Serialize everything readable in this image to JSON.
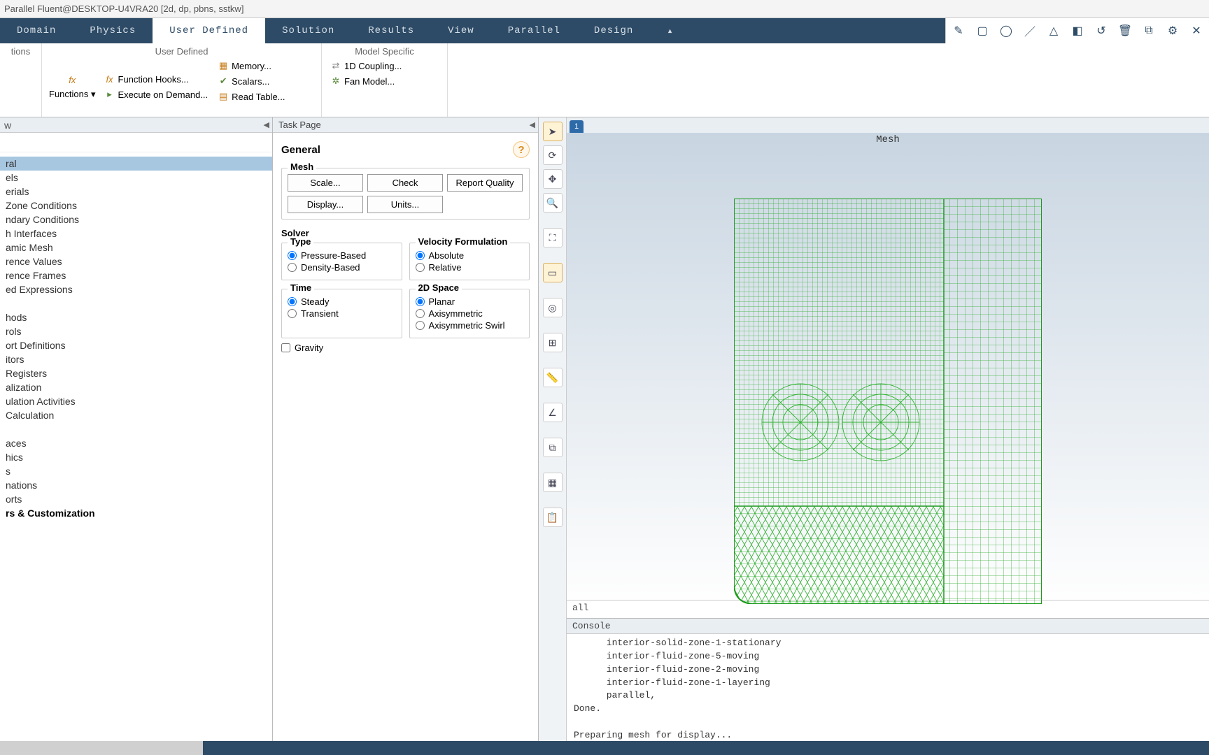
{
  "window_title": "Parallel Fluent@DESKTOP-U4VRA20 [2d, dp, pbns, sstkw]",
  "menu": {
    "tabs": [
      "Domain",
      "Physics",
      "User Defined",
      "Solution",
      "Results",
      "View",
      "Parallel",
      "Design"
    ],
    "active_index": 2
  },
  "ribbon": {
    "group0_label": "tions",
    "group1_label": "User Defined",
    "group1_functions": "Functions ▾",
    "group1_hooks": "Function Hooks...",
    "group1_exec": "Execute on Demand...",
    "group2_memory": "Memory...",
    "group2_scalars": "Scalars...",
    "group2_read": "Read Table...",
    "group3_label": "Model Specific",
    "group3_1d": "1D Coupling...",
    "group3_fan": "Fan Model..."
  },
  "outline": {
    "header": "w",
    "items": [
      {
        "label": "ral",
        "sel": true
      },
      {
        "label": "els"
      },
      {
        "label": "erials"
      },
      {
        "label": "Zone Conditions"
      },
      {
        "label": "ndary Conditions"
      },
      {
        "label": "h Interfaces"
      },
      {
        "label": "amic Mesh"
      },
      {
        "label": "rence Values"
      },
      {
        "label": "rence Frames"
      },
      {
        "label": "ed Expressions"
      },
      {
        "label": ""
      },
      {
        "label": "hods"
      },
      {
        "label": "rols"
      },
      {
        "label": "ort Definitions"
      },
      {
        "label": "itors"
      },
      {
        "label": "Registers"
      },
      {
        "label": "alization"
      },
      {
        "label": "ulation Activities"
      },
      {
        "label": "Calculation"
      },
      {
        "label": ""
      },
      {
        "label": "aces"
      },
      {
        "label": "hics"
      },
      {
        "label": "s"
      },
      {
        "label": "nations"
      },
      {
        "label": "orts"
      },
      {
        "label": "rs & Customization",
        "bold": true
      }
    ]
  },
  "task": {
    "header": "Task Page",
    "title": "General",
    "mesh_label": "Mesh",
    "btn_scale": "Scale...",
    "btn_check": "Check",
    "btn_quality": "Report Quality",
    "btn_display": "Display...",
    "btn_units": "Units...",
    "solver_label": "Solver",
    "type_label": "Type",
    "type_pressure": "Pressure-Based",
    "type_density": "Density-Based",
    "vel_label": "Velocity Formulation",
    "vel_abs": "Absolute",
    "vel_rel": "Relative",
    "time_label": "Time",
    "time_steady": "Steady",
    "time_trans": "Transient",
    "space_label": "2D Space",
    "space_planar": "Planar",
    "space_axi": "Axisymmetric",
    "space_swirl": "Axisymmetric Swirl",
    "gravity": "Gravity"
  },
  "graphics": {
    "tab": "1",
    "title": "Mesh",
    "footer": "all"
  },
  "console": {
    "header": "Console",
    "lines": "      interior-solid-zone-1-stationary\n      interior-fluid-zone-5-moving\n      interior-fluid-zone-2-moving\n      interior-fluid-zone-1-layering\n      parallel,\nDone.\n\nPreparing mesh for display...\nDone."
  }
}
